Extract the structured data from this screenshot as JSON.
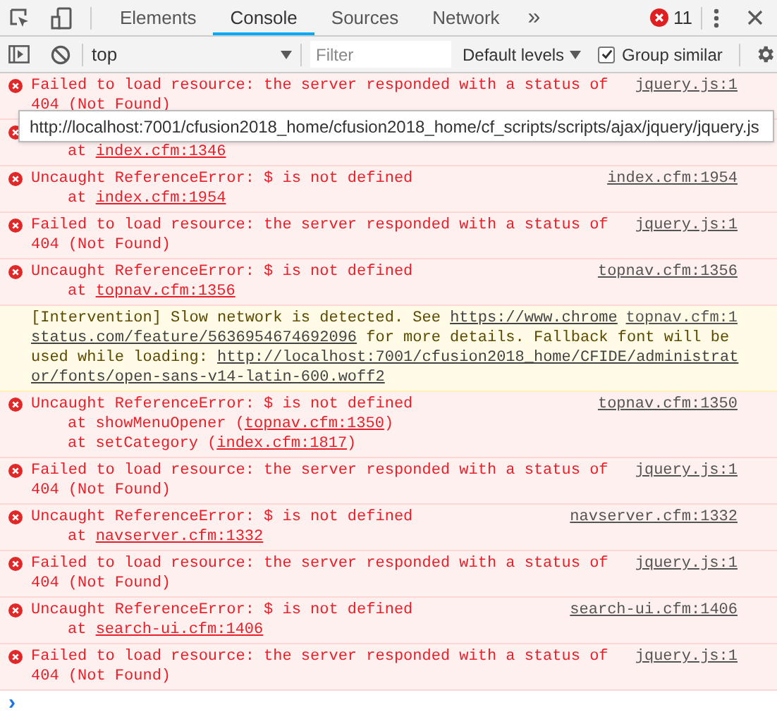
{
  "tabs": [
    {
      "label": "Elements",
      "selected": false
    },
    {
      "label": "Console",
      "selected": true
    },
    {
      "label": "Sources",
      "selected": false
    },
    {
      "label": "Network",
      "selected": false
    }
  ],
  "more_tabs": "»",
  "error_count": "11",
  "console_toolbar": {
    "context": "top",
    "filter_placeholder": "Filter",
    "levels": "Default levels",
    "group_similar": {
      "label": "Group similar",
      "checked": true
    }
  },
  "messages": [
    {
      "kind": "error",
      "source": "jquery.js:1",
      "lines": [
        {
          "segments": [
            {
              "text": "Failed to load resource: the server responded with a status of"
            }
          ]
        },
        {
          "segments": [
            {
              "text": "404 (Not Found)"
            }
          ]
        }
      ]
    },
    {
      "kind": "error",
      "covered": true,
      "lines": [
        {
          "trace": true,
          "segments": [
            {
              "text": "at "
            },
            {
              "text": "index.cfm:1346",
              "link": true
            }
          ]
        }
      ]
    },
    {
      "kind": "error",
      "source": "index.cfm:1954",
      "lines": [
        {
          "segments": [
            {
              "text": "Uncaught ReferenceError: $ is not defined"
            }
          ]
        },
        {
          "trace": true,
          "segments": [
            {
              "text": "at "
            },
            {
              "text": "index.cfm:1954",
              "link": true
            }
          ]
        }
      ]
    },
    {
      "kind": "error",
      "source": "jquery.js:1",
      "lines": [
        {
          "segments": [
            {
              "text": "Failed to load resource: the server responded with a status of"
            }
          ]
        },
        {
          "segments": [
            {
              "text": "404 (Not Found)"
            }
          ]
        }
      ]
    },
    {
      "kind": "error",
      "source": "topnav.cfm:1356",
      "lines": [
        {
          "segments": [
            {
              "text": "Uncaught ReferenceError: $ is not defined"
            }
          ]
        },
        {
          "trace": true,
          "segments": [
            {
              "text": "at "
            },
            {
              "text": "topnav.cfm:1356",
              "link": true
            }
          ]
        }
      ]
    },
    {
      "kind": "warning",
      "source": "topnav.cfm:1",
      "lines": [
        {
          "segments": [
            {
              "text": "[Intervention] Slow network is detected. See "
            },
            {
              "text": "https://www.chrome",
              "link": true
            }
          ]
        },
        {
          "wide": true,
          "segments": [
            {
              "text": "status.com/feature/5636954674692096",
              "link": true
            },
            {
              "text": " for more details. Fallback font will be"
            }
          ]
        },
        {
          "wide": true,
          "segments": [
            {
              "text": "used while loading: "
            },
            {
              "text": "http://localhost:7001/cfusion2018_home/CFIDE/administrat",
              "link": true
            }
          ]
        },
        {
          "wide": true,
          "segments": [
            {
              "text": "or/fonts/open-sans-v14-latin-600.woff2",
              "link": true
            }
          ]
        }
      ]
    },
    {
      "kind": "error",
      "source": "topnav.cfm:1350",
      "lines": [
        {
          "segments": [
            {
              "text": "Uncaught ReferenceError: $ is not defined"
            }
          ]
        },
        {
          "trace": true,
          "segments": [
            {
              "text": "at showMenuOpener ("
            },
            {
              "text": "topnav.cfm:1350",
              "link": true
            },
            {
              "text": ")"
            }
          ]
        },
        {
          "trace": true,
          "segments": [
            {
              "text": "at setCategory ("
            },
            {
              "text": "index.cfm:1817",
              "link": true
            },
            {
              "text": ")"
            }
          ]
        }
      ]
    },
    {
      "kind": "error",
      "source": "jquery.js:1",
      "lines": [
        {
          "segments": [
            {
              "text": "Failed to load resource: the server responded with a status of"
            }
          ]
        },
        {
          "segments": [
            {
              "text": "404 (Not Found)"
            }
          ]
        }
      ]
    },
    {
      "kind": "error",
      "source": "navserver.cfm:1332",
      "lines": [
        {
          "segments": [
            {
              "text": "Uncaught ReferenceError: $ is not defined"
            }
          ]
        },
        {
          "trace": true,
          "segments": [
            {
              "text": "at "
            },
            {
              "text": "navserver.cfm:1332",
              "link": true
            }
          ]
        }
      ]
    },
    {
      "kind": "error",
      "source": "jquery.js:1",
      "lines": [
        {
          "segments": [
            {
              "text": "Failed to load resource: the server responded with a status of"
            }
          ]
        },
        {
          "segments": [
            {
              "text": "404 (Not Found)"
            }
          ]
        }
      ]
    },
    {
      "kind": "error",
      "source": "search-ui.cfm:1406",
      "lines": [
        {
          "segments": [
            {
              "text": "Uncaught ReferenceError: $ is not defined"
            }
          ]
        },
        {
          "trace": true,
          "segments": [
            {
              "text": "at "
            },
            {
              "text": "search-ui.cfm:1406",
              "link": true
            }
          ]
        }
      ]
    },
    {
      "kind": "error",
      "source": "jquery.js:1",
      "lines": [
        {
          "segments": [
            {
              "text": "Failed to load resource: the server responded with a status of"
            }
          ]
        },
        {
          "segments": [
            {
              "text": "404 (Not Found)"
            }
          ]
        }
      ]
    }
  ],
  "tooltip": "http://localhost:7001/cfusion2018_home/cfusion2018_home/cf_scripts/scripts/ajax/jquery/jquery.js",
  "prompt": "›"
}
